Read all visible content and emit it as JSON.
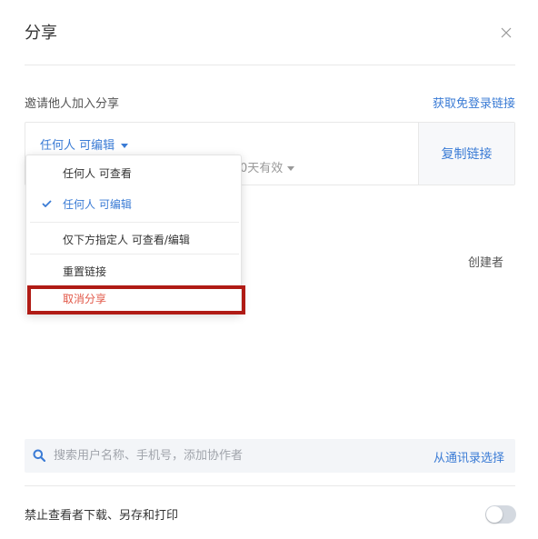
{
  "dialog": {
    "title": "分享",
    "close_icon": "close-icon"
  },
  "invite": {
    "label": "邀请他人加入分享",
    "get_link_text": "获取免登录链接"
  },
  "link_box": {
    "permission_value": "任何人 可编辑",
    "expiry_text": "0天有效",
    "copy_button": "复制链接"
  },
  "dropdown": {
    "items": [
      {
        "label": "任何人 可查看",
        "selected": false
      },
      {
        "label": "任何人 可编辑",
        "selected": true
      },
      {
        "label": "仅下方指定人 可查看/编辑",
        "selected": false
      },
      {
        "label": "重置链接",
        "selected": false
      },
      {
        "label": "取消分享",
        "selected": false
      }
    ],
    "check_icon": "check-icon"
  },
  "members": {
    "creator_label": "创建者"
  },
  "search": {
    "placeholder": "搜索用户名称、手机号，添加协作者",
    "contacts_link": "从通讯录选择",
    "icon": "search-icon"
  },
  "settings": {
    "restrict_label": "禁止查看者下载、另存和打印",
    "restrict_enabled": false
  },
  "colors": {
    "accent": "#3a7bd5",
    "danger": "#e25848",
    "highlight_border": "#b01b15"
  }
}
